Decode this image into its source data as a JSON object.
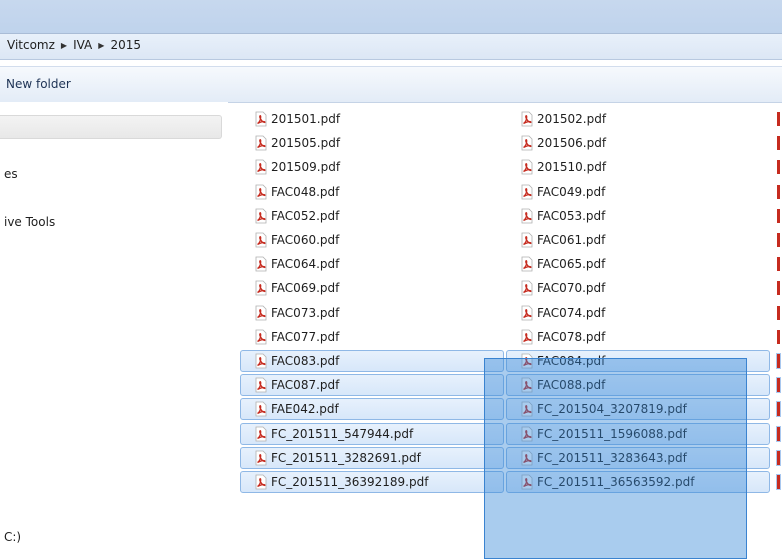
{
  "breadcrumb": [
    "Vitcomz",
    "IVA",
    "2015"
  ],
  "toolbar": {
    "new_folder": "New folder"
  },
  "nav": {
    "items": [
      "es",
      "ive Tools",
      "C:)"
    ]
  },
  "files": {
    "col1": [
      "201501.pdf",
      "201505.pdf",
      "201509.pdf",
      "FAC048.pdf",
      "FAC052.pdf",
      "FAC060.pdf",
      "FAC064.pdf",
      "FAC069.pdf",
      "FAC073.pdf",
      "FAC077.pdf",
      "FAC083.pdf",
      "FAC087.pdf",
      "FAE042.pdf",
      "FC_201511_547944.pdf",
      "FC_201511_3282691.pdf",
      "FC_201511_36392189.pdf"
    ],
    "col2": [
      "201502.pdf",
      "201506.pdf",
      "201510.pdf",
      "FAC049.pdf",
      "FAC053.pdf",
      "FAC061.pdf",
      "FAC065.pdf",
      "FAC070.pdf",
      "FAC074.pdf",
      "FAC078.pdf",
      "FAC084.pdf",
      "FAC088.pdf",
      "FC_201504_3207819.pdf",
      "FC_201511_1596088.pdf",
      "FC_201511_3283643.pdf",
      "FC_201511_36563592.pdf"
    ],
    "selected_from_row": 10
  },
  "icons": {
    "file": "pdf-file-icon",
    "crumb_separator": "triangle-right-icon"
  },
  "colors": {
    "selection_fill": "#d7e7fa",
    "selection_border": "#8fb8e6",
    "marquee": "#3385d6",
    "pdf_red": "#c62b1f"
  }
}
